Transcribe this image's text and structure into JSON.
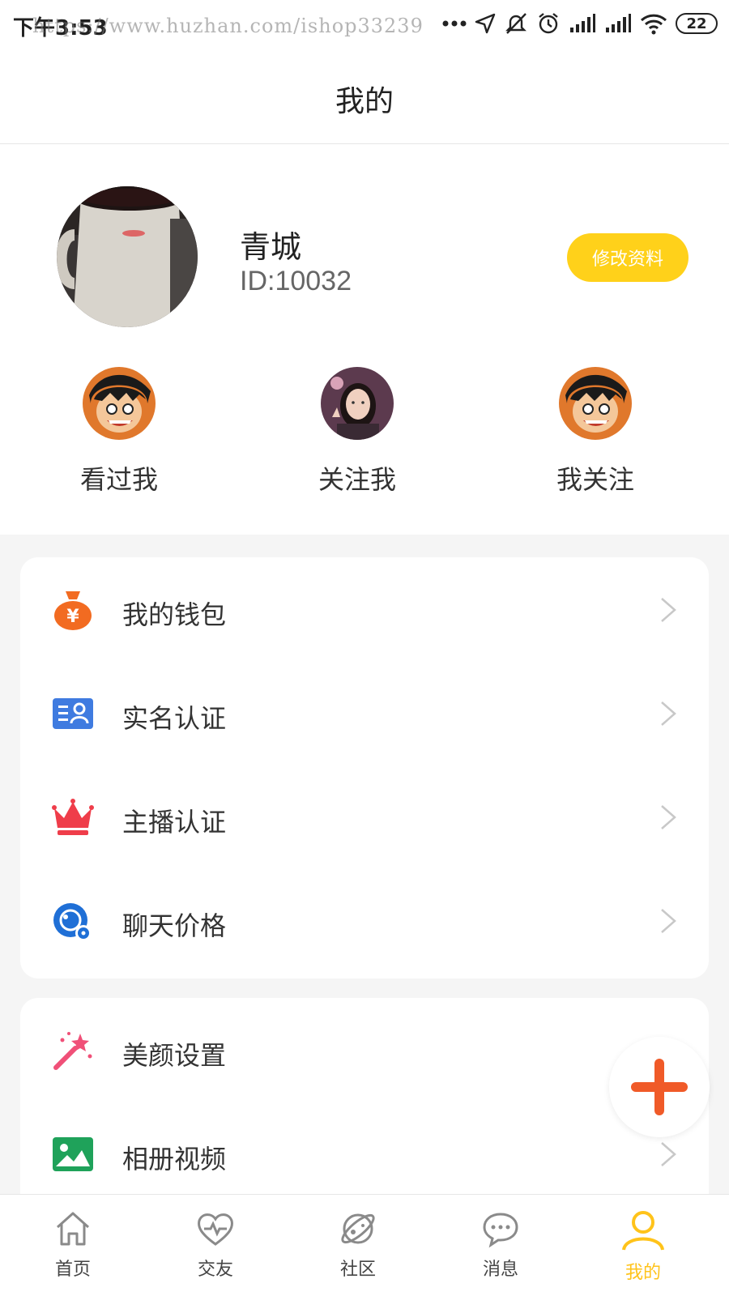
{
  "status_bar": {
    "time": "下午3:53",
    "watermark": "https://www.huzhan.com/ishop33239",
    "battery": "22"
  },
  "header": {
    "title": "我的"
  },
  "profile": {
    "name": "青城",
    "id": "ID:10032",
    "edit_button": "修改资料"
  },
  "stats": [
    {
      "label": "看过我"
    },
    {
      "label": "关注我"
    },
    {
      "label": "我关注"
    }
  ],
  "menu_group_1": [
    {
      "label": "我的钱包",
      "icon": "wallet-icon"
    },
    {
      "label": "实名认证",
      "icon": "id-card-icon"
    },
    {
      "label": "主播认证",
      "icon": "crown-icon"
    },
    {
      "label": "聊天价格",
      "icon": "chat-price-icon"
    }
  ],
  "menu_group_2": [
    {
      "label": "美颜设置",
      "icon": "magic-wand-icon"
    },
    {
      "label": "相册视频",
      "icon": "album-icon"
    }
  ],
  "tabs": [
    {
      "label": "首页",
      "icon": "home-icon"
    },
    {
      "label": "交友",
      "icon": "heart-pulse-icon"
    },
    {
      "label": "社区",
      "icon": "planet-icon"
    },
    {
      "label": "消息",
      "icon": "message-icon"
    },
    {
      "label": "我的",
      "icon": "user-icon",
      "active": true
    }
  ],
  "colors": {
    "accent": "#ffd11a",
    "active_tab": "#ffc31a",
    "fab_plus": "#f05a28"
  }
}
